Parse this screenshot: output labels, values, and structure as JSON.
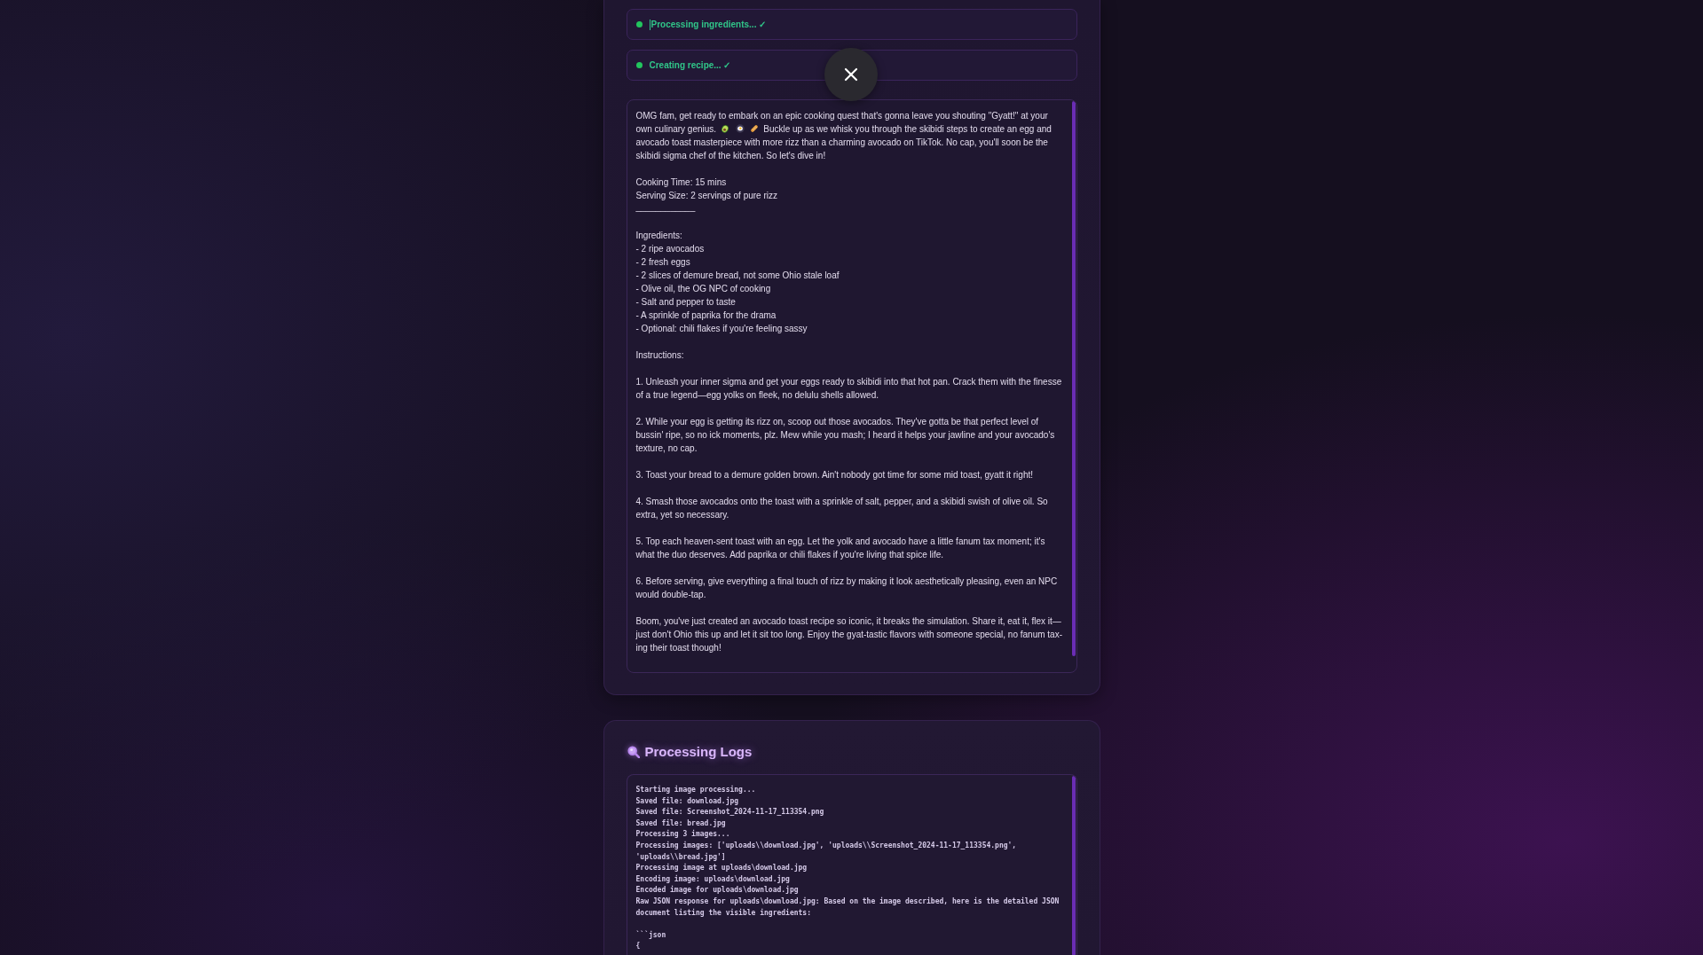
{
  "status_steps": [
    {
      "label": "Processing ingredients... ✓",
      "done": true,
      "cursor": true
    },
    {
      "label": "Creating recipe... ✓",
      "done": true,
      "cursor": false
    }
  ],
  "recipe": {
    "intro": {
      "before": "OMG fam, get ready to embark on an epic cooking quest that's gonna leave you shouting \"Gyatt!\" at your own culinary genius.",
      "after": "Buckle up as we whisk you through the skibidi steps to create an egg and avocado toast masterpiece with more rizz than a charming avocado on TikTok. No cap, you'll soon be the skibidi sigma chef of the kitchen. So let's dive in!"
    },
    "details": [
      "Cooking Time: 15 mins",
      "Serving Size: 2 servings of pure rizz"
    ],
    "divider": "____________",
    "ingredients_heading": "Ingredients:",
    "ingredients": [
      "- 2 ripe avocados",
      "- 2 fresh eggs",
      "- 2 slices of demure bread, not some Ohio stale loaf",
      "- Olive oil, the OG NPC of cooking",
      "- Salt and pepper to taste",
      "- A sprinkle of paprika for the drama",
      "- Optional: chili flakes if you're feeling sassy"
    ],
    "instructions_heading": "Instructions:",
    "steps": [
      "1. Unleash your inner sigma and get your eggs ready to skibidi into that hot pan. Crack them with the finesse of a true legend—egg yolks on fleek, no delulu shells allowed.",
      "2. While your egg is getting its rizz on, scoop out those avocados. They've gotta be that perfect level of bussin' ripe, so no ick moments, plz. Mew while you mash; I heard it helps your jawline and your avocado's texture, no cap.",
      "3. Toast your bread to a demure golden brown. Ain't nobody got time for some mid toast, gyatt it right!",
      "4. Smash those avocados onto the toast with a sprinkle of salt, pepper, and a skibidi swish of olive oil. So extra, yet so necessary.",
      "5. Top each heaven-sent toast with an egg. Let the yolk and avocado have a little fanum tax moment; it's what the duo deserves. Add paprika or chili flakes if you're living that spice life.",
      "6. Before serving, give everything a final touch of rizz by making it look aesthetically pleasing, even an NPC would double-tap."
    ],
    "outro": "Boom, you've just created an avocado toast recipe so iconic, it breaks the simulation. Share it, eat it, flex it—just don't Ohio this up and let it sit too long. Enjoy the gyat-tastic flavors with someone special, no fanum tax-ing their toast though!"
  },
  "logs_panel": {
    "title": "Processing Logs",
    "lines": [
      "Starting image processing...",
      "Saved file: download.jpg",
      "Saved file: Screenshot_2024-11-17_113354.png",
      "Saved file: bread.jpg",
      "Processing 3 images...",
      "Processing images: ['uploads\\\\download.jpg', 'uploads\\\\Screenshot_2024-11-17_113354.png', 'uploads\\\\bread.jpg']",
      "Processing image at uploads\\download.jpg",
      "Encoding image: uploads\\download.jpg",
      "Encoded image for uploads\\download.jpg",
      "Raw JSON response for uploads\\download.jpg: Based on the image described, here is the detailed JSON document listing the visible ingredients:\n\n```json\n{"
    ]
  }
}
